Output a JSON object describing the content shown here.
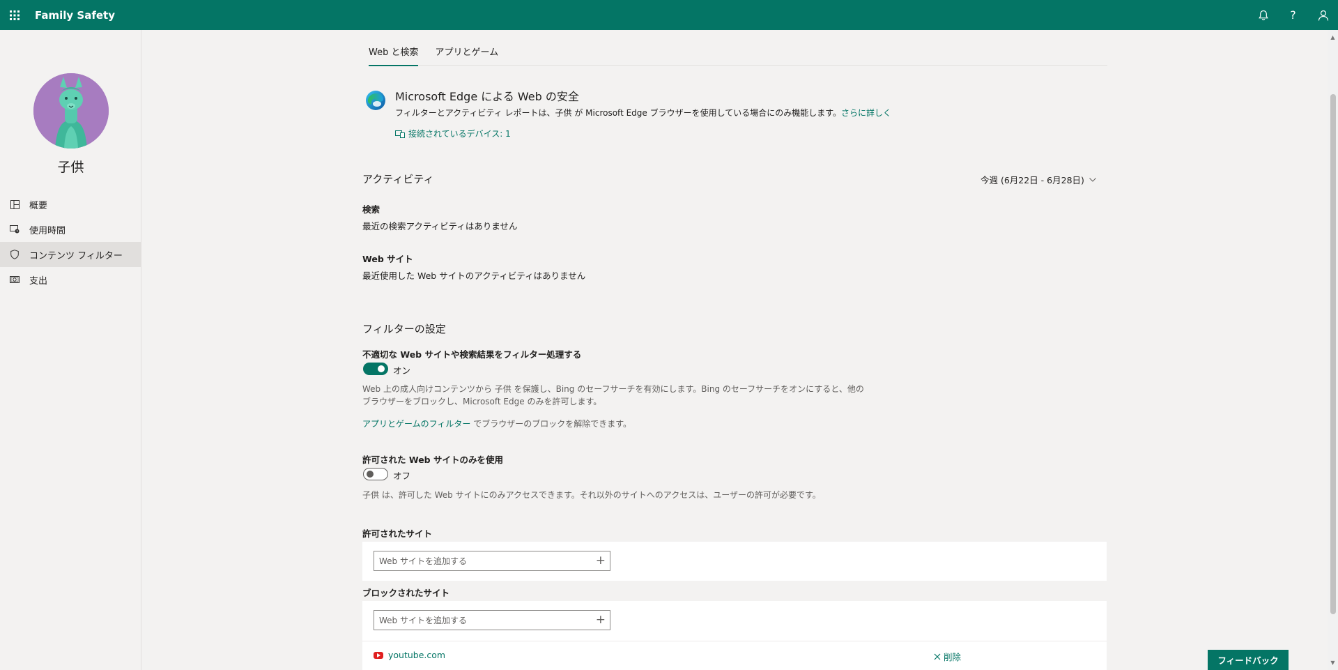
{
  "app": {
    "title": "Family Safety",
    "icons": {
      "waffle": "waffle-icon",
      "bell": "bell-icon",
      "help": "help-icon",
      "profile": "person-icon"
    },
    "help_glyph": "?"
  },
  "sidebar": {
    "child_name": "子供",
    "items": [
      {
        "label": "概要",
        "icon": "overview-icon"
      },
      {
        "label": "使用時間",
        "icon": "screen-time-icon"
      },
      {
        "label": "コンテンツ フィルター",
        "icon": "shield-icon",
        "active": true
      },
      {
        "label": "支出",
        "icon": "money-icon"
      }
    ]
  },
  "tabs": [
    {
      "label": "Web と検索",
      "active": true
    },
    {
      "label": "アプリとゲーム",
      "active": false
    }
  ],
  "edge": {
    "title": "Microsoft Edge による Web の安全",
    "description": "フィルターとアクティビティ レポートは、子供 が Microsoft Edge ブラウザーを使用している場合にのみ機能します。",
    "learn_more": "さらに詳しく",
    "devices": "接続されているデバイス: 1"
  },
  "activity": {
    "heading": "アクティビティ",
    "period": "今週 (6月22日 - 6月28日)",
    "search_label": "検索",
    "search_empty": "最近の検索アクティビティはありません",
    "web_label": "Web サイト",
    "web_empty": "最近使用した Web サイトのアクティビティはありません"
  },
  "filter_settings": {
    "heading": "フィルターの設定",
    "inappropriate": {
      "label": "不適切な Web サイトや検索結果をフィルター処理する",
      "state": "オン",
      "desc_line1": "Web 上の成人向けコンテンツから 子供 を保護し、Bing のセーフサーチを有効にします。Bing のセーフサーチをオンにすると、他の",
      "desc_line2": "ブラウザーをブロックし、Microsoft Edge のみを許可します。",
      "apps_link": "アプリとゲームのフィルター",
      "apps_link_suffix": " でブラウザーのブロックを解除できます。"
    },
    "allowed_only": {
      "label": "許可された Web サイトのみを使用",
      "state": "オフ",
      "desc": "子供 は、許可した Web サイトにのみアクセスできます。それ以外のサイトへのアクセスは、ユーザーの許可が必要です。"
    }
  },
  "allowed_sites": {
    "heading": "許可されたサイト",
    "placeholder": "Web サイトを追加する"
  },
  "blocked_sites": {
    "heading": "ブロックされたサイト",
    "placeholder": "Web サイトを追加する",
    "items": [
      {
        "site": "youtube.com",
        "icon": "youtube-icon",
        "remove_label": "削除"
      }
    ]
  },
  "feedback": "フィードバック",
  "colors": {
    "brand": "#047565",
    "background": "#f3f2f1",
    "avatar": "#a77cc0",
    "youtube": "#e02020"
  }
}
